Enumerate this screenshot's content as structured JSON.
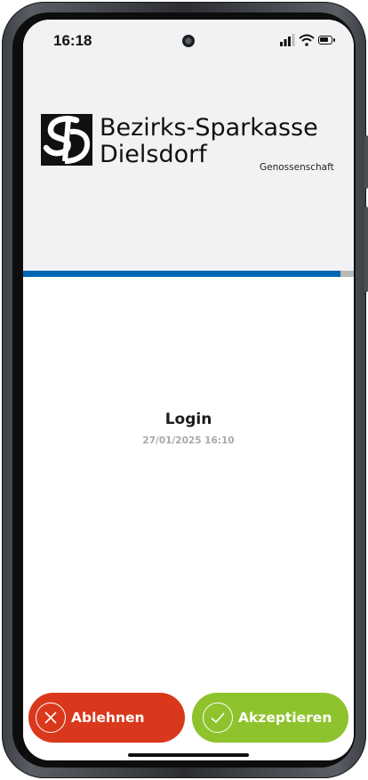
{
  "status_bar": {
    "time": "16:18",
    "icons": [
      "signal-icon",
      "wifi-icon",
      "battery-icon"
    ]
  },
  "bank": {
    "name_line1": "Bezirks-Sparkasse",
    "name_line2": "Dielsdorf",
    "subtitle": "Genossenschaft"
  },
  "progress": {
    "value_percent": 96,
    "fill_color": "#0066b3",
    "track_color": "#b9b9b9"
  },
  "request": {
    "title": "Login",
    "timestamp": "27/01/2025 16:10"
  },
  "actions": {
    "reject_label": "Ablehnen",
    "reject_icon": "close-circle-icon",
    "reject_color": "#d9381c",
    "accept_label": "Akzeptieren",
    "accept_icon": "check-circle-icon",
    "accept_color": "#8ec32d"
  }
}
